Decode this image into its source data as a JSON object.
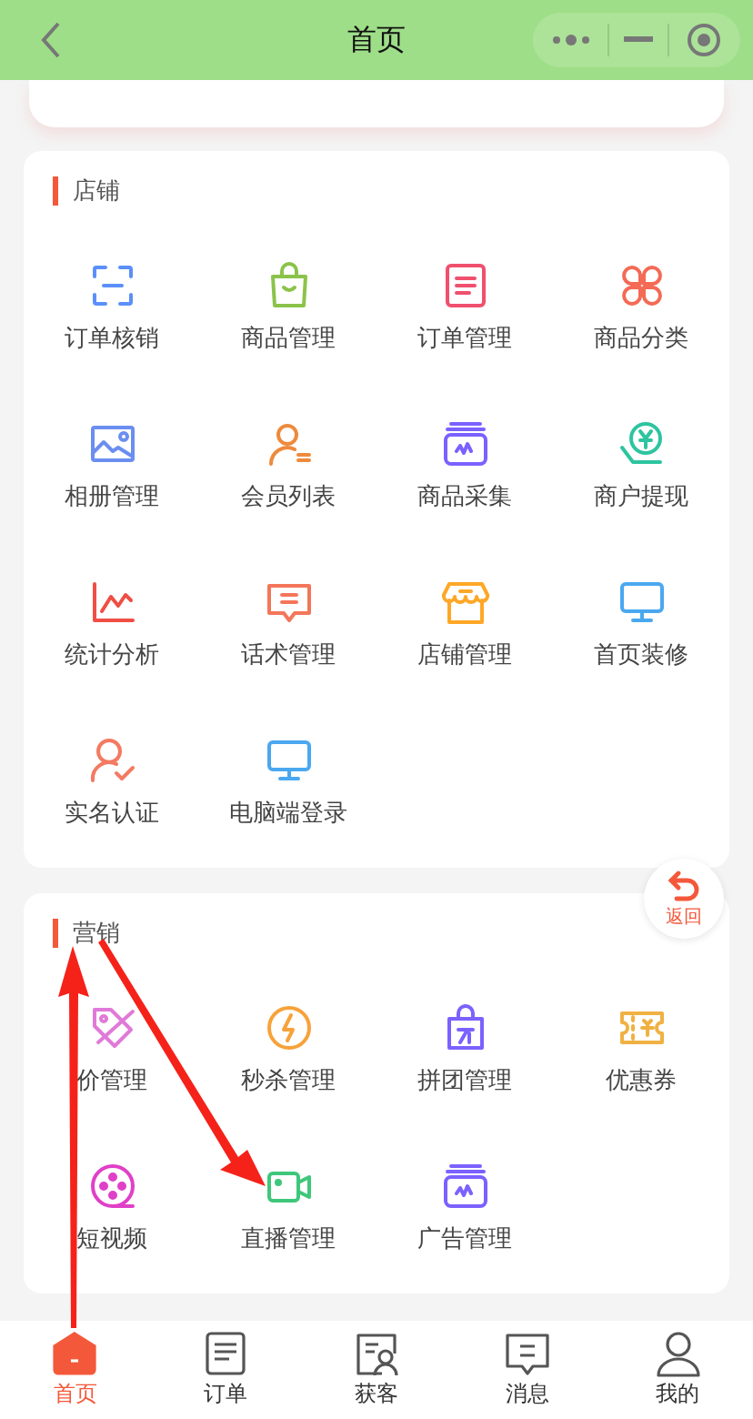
{
  "header": {
    "title": "首页"
  },
  "sections": [
    {
      "title": "店铺",
      "items": [
        {
          "label": "订单核销"
        },
        {
          "label": "商品管理"
        },
        {
          "label": "订单管理"
        },
        {
          "label": "商品分类"
        },
        {
          "label": "相册管理"
        },
        {
          "label": "会员列表"
        },
        {
          "label": "商品采集"
        },
        {
          "label": "商户提现"
        },
        {
          "label": "统计分析"
        },
        {
          "label": "话术管理"
        },
        {
          "label": "店铺管理"
        },
        {
          "label": "首页装修"
        },
        {
          "label": "实名认证"
        },
        {
          "label": "电脑端登录"
        }
      ]
    },
    {
      "title": "营销",
      "items": [
        {
          "label": "价管理"
        },
        {
          "label": "秒杀管理"
        },
        {
          "label": "拼团管理"
        },
        {
          "label": "优惠券"
        },
        {
          "label": "短视频"
        },
        {
          "label": "直播管理"
        },
        {
          "label": "广告管理"
        }
      ]
    }
  ],
  "float_button": {
    "label": "返回"
  },
  "tabbar": [
    {
      "label": "首页",
      "selected": true
    },
    {
      "label": "订单",
      "selected": false
    },
    {
      "label": "获客",
      "selected": false
    },
    {
      "label": "消息",
      "selected": false
    },
    {
      "label": "我的",
      "selected": false
    }
  ]
}
